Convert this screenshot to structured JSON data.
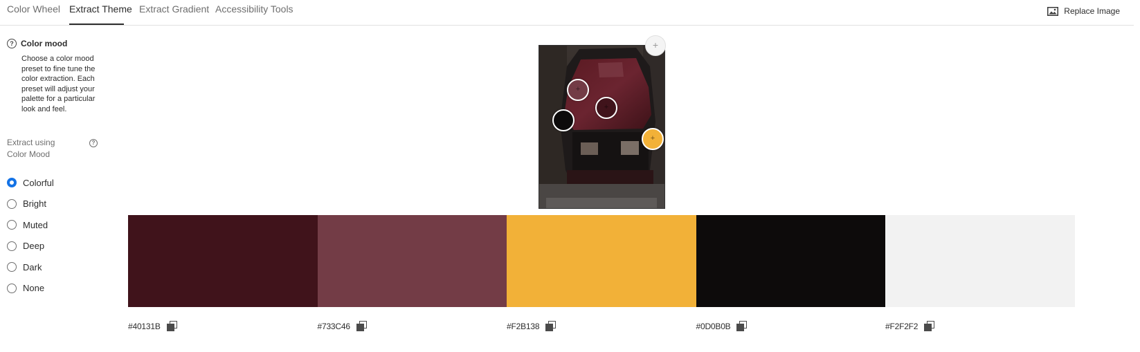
{
  "tabs": [
    {
      "label": "Color Wheel",
      "active": false
    },
    {
      "label": "Extract Theme",
      "active": true
    },
    {
      "label": "Extract Gradient",
      "active": false
    },
    {
      "label": "Accessibility Tools",
      "active": false
    }
  ],
  "header": {
    "replace_label": "Replace Image",
    "replace_icon": "image-icon"
  },
  "sidebar": {
    "mood_title": "Color mood",
    "mood_help_icon": "help-circle-icon",
    "mood_description": "Choose a color mood preset to fine tune the color extraction. Each preset will adjust your palette for a particular look and feel.",
    "extract_label": "Extract using Color Mood",
    "options": [
      {
        "label": "Colorful",
        "checked": true
      },
      {
        "label": "Bright",
        "checked": false
      },
      {
        "label": "Muted",
        "checked": false
      },
      {
        "label": "Deep",
        "checked": false
      },
      {
        "label": "Dark",
        "checked": false
      },
      {
        "label": "None",
        "checked": false
      }
    ]
  },
  "image": {
    "add_label": "+"
  },
  "pickers": [
    {
      "color": "#733C46"
    },
    {
      "color": "#40131B"
    },
    {
      "color": "#0D0B0B"
    },
    {
      "color": "#F2B138"
    }
  ],
  "swatches": [
    {
      "hex": "#40131B"
    },
    {
      "hex": "#733C46"
    },
    {
      "hex": "#F2B138"
    },
    {
      "hex": "#0D0B0B"
    },
    {
      "hex": "#F2F2F2"
    }
  ],
  "colors": {
    "accent": "#1473e6",
    "text": "#2c2c2c",
    "muted_text": "#6e6e6e"
  }
}
